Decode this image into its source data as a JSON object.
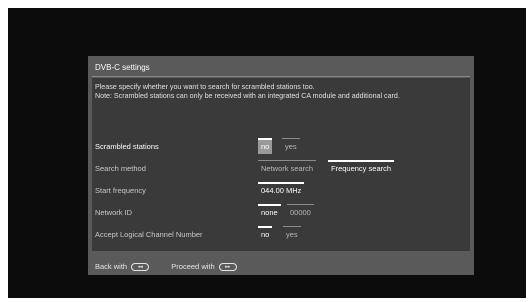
{
  "dialog": {
    "title": "DVB-C settings",
    "description_line1": "Please specify whether you want to search for scrambled stations too.",
    "description_line2": "Note: Scrambled stations can only be received with an integrated CA module and additional card."
  },
  "settings": {
    "scrambled": {
      "label": "Scrambled stations",
      "opt_no": "no",
      "opt_yes": "yes",
      "selected": "no"
    },
    "search_method": {
      "label": "Search method",
      "opt_network": "Network search",
      "opt_frequency": "Frequency search",
      "selected": "Frequency search"
    },
    "start_frequency": {
      "label": "Start frequency",
      "value": "044.00 MHz"
    },
    "network_id": {
      "label": "Network ID",
      "opt_none": "none",
      "opt_value": "00000",
      "selected": "none"
    },
    "lcn": {
      "label": "Accept Logical Channel Number",
      "opt_no": "no",
      "opt_yes": "yes",
      "selected": "no"
    }
  },
  "footer": {
    "back_label": "Back with",
    "back_icon": "rewind-button-icon",
    "proceed_label": "Proceed with",
    "proceed_icon": "fast-forward-button-icon"
  },
  "colors": {
    "screen_bg": "#0c0c0c",
    "dialog_bg": "#5a5a5a",
    "panel_bg": "#3a3a3a",
    "focus_bg": "#9a9a9a"
  }
}
